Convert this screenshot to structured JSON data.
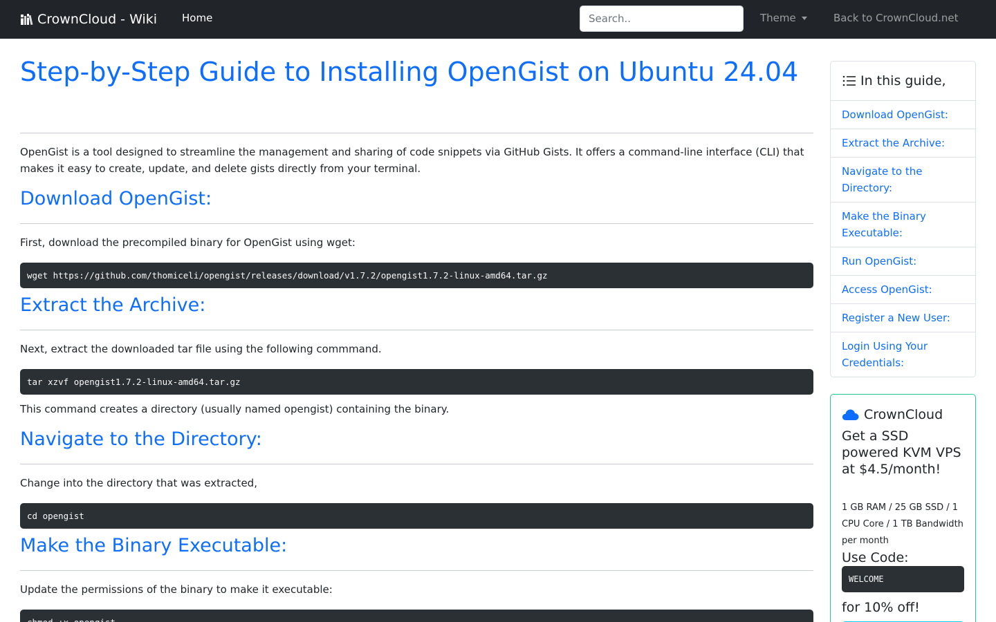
{
  "navbar": {
    "brand": "CrownCloud - Wiki",
    "home": "Home",
    "search_placeholder": "Search..",
    "theme": "Theme",
    "back": "Back to CrownCloud.net"
  },
  "article": {
    "title": "Step-by-Step Guide to Installing OpenGist on Ubuntu 24.04",
    "intro": "OpenGist is a tool designed to streamline the management and sharing of code snippets via GitHub Gists. It offers a command-line interface (CLI) that makes it easy to create, update, and delete gists directly from your terminal.",
    "sections": [
      {
        "heading": "Download OpenGist:",
        "text": "First, download the precompiled binary for OpenGist using wget:",
        "code": "wget https://github.com/thomiceli/opengist/releases/download/v1.7.2/opengist1.7.2-linux-amd64.tar.gz"
      },
      {
        "heading": "Extract the Archive:",
        "text": "Next, extract the downloaded tar file using the following commmand.",
        "code": "tar xzvf opengist1.7.2-linux-amd64.tar.gz",
        "after": "This command creates a directory (usually named opengist) containing the binary."
      },
      {
        "heading": "Navigate to the Directory:",
        "text": "Change into the directory that was extracted,",
        "code": "cd opengist"
      },
      {
        "heading": "Make the Binary Executable:",
        "text": "Update the permissions of the binary to make it executable:",
        "code": "chmod +x opengist"
      }
    ]
  },
  "toc": {
    "title": "In this guide,",
    "items": [
      "Download OpenGist:",
      "Extract the Archive:",
      "Navigate to the Directory:",
      "Make the Binary Executable:",
      "Run OpenGist:",
      "Access OpenGist:",
      "Register a New User:",
      "Login Using Your Credentials:"
    ]
  },
  "promo": {
    "title": "CrownCloud",
    "headline": "Get a SSD powered KVM VPS at $4.5/month!",
    "specs": "1 GB RAM / 25 GB SSD / 1 CPU Core / 1 TB Bandwidth per month",
    "use_code": "Use Code:",
    "code": "WELCOME",
    "discount": "for 10% off!"
  },
  "colors": {
    "navbar_bg": "#212529",
    "link_blue": "#0d6efd",
    "code_bg": "#2b3035",
    "promo_border": "#20c997",
    "button_cyan": "#0dcaf0"
  },
  "icons": [
    "books-icon",
    "list-icon",
    "cloud-icon",
    "chevron-down-icon"
  ]
}
